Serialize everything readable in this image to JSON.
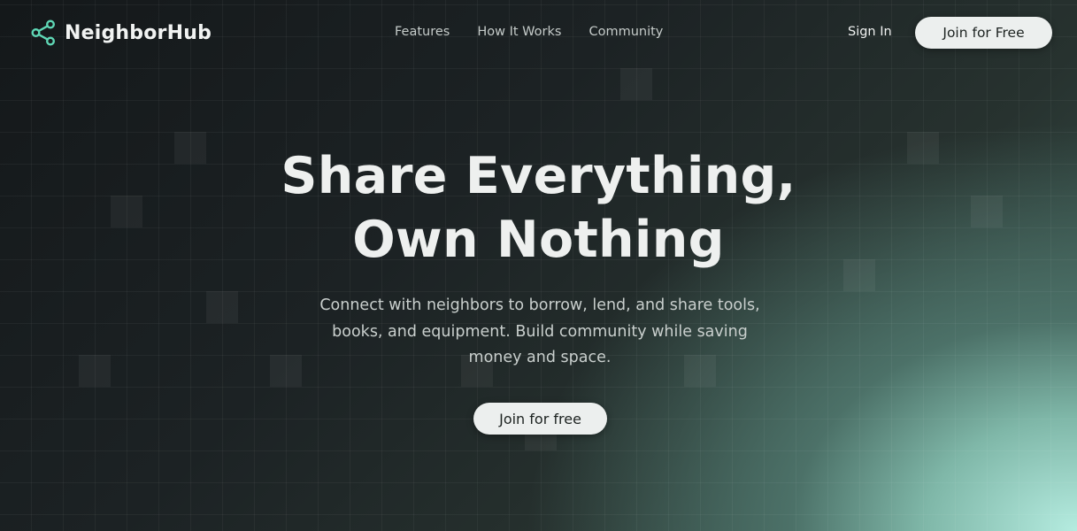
{
  "header": {
    "brand": "NeighborHub",
    "logo_icon": "share-network-icon",
    "accent_color": "#5fd8b6",
    "nav": [
      "Features",
      "How It Works",
      "Community"
    ],
    "sign_in": "Sign In",
    "cta": "Join for Free"
  },
  "hero": {
    "title_line1": "Share Everything,",
    "title_line2": "Own Nothing",
    "subtitle": "Connect with neighbors to borrow, lend, and share tools, books, and equipment. Build community while saving money and space.",
    "cta": "Join for free"
  }
}
